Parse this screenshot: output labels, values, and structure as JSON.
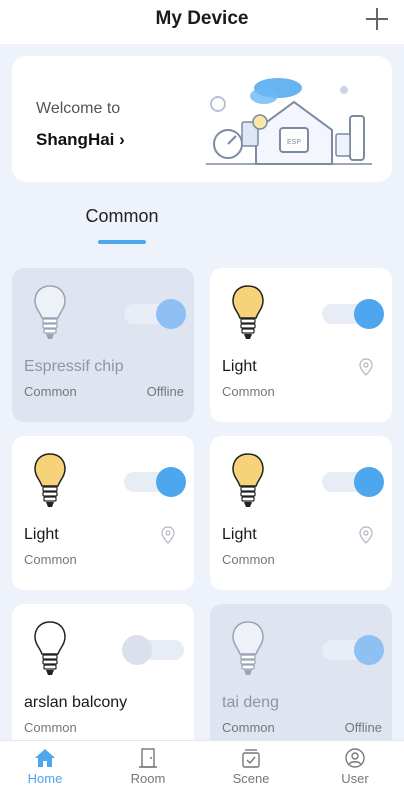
{
  "header": {
    "title": "My Device",
    "add_icon": "plus-icon"
  },
  "welcome": {
    "greeting": "Welcome to",
    "city": "ShangHai",
    "city_icon": "chevron-right-icon"
  },
  "tabs": [
    {
      "label": "Common",
      "active": true
    }
  ],
  "devices": [
    {
      "name": "Espressif chip",
      "room": "Common",
      "status": "Offline",
      "on": true,
      "online": false,
      "bulb_lit": false
    },
    {
      "name": "Light",
      "room": "Common",
      "status": "",
      "on": true,
      "online": true,
      "bulb_lit": true
    },
    {
      "name": "Light",
      "room": "Common",
      "status": "",
      "on": true,
      "online": true,
      "bulb_lit": true
    },
    {
      "name": "Light",
      "room": "Common",
      "status": "",
      "on": true,
      "online": true,
      "bulb_lit": true
    },
    {
      "name": "arslan balcony",
      "room": "Common",
      "status": "",
      "on": false,
      "online": true,
      "bulb_lit": false
    },
    {
      "name": "tai deng",
      "room": "Common",
      "status": "Offline",
      "on": true,
      "online": false,
      "bulb_lit": false
    }
  ],
  "nav": [
    {
      "label": "Home",
      "icon": "home-icon",
      "active": true
    },
    {
      "label": "Room",
      "icon": "door-icon",
      "active": false
    },
    {
      "label": "Scene",
      "icon": "scene-icon",
      "active": false
    },
    {
      "label": "User",
      "icon": "user-icon",
      "active": false
    }
  ],
  "colors": {
    "accent": "#4ea6ee",
    "background": "#eef2fb",
    "offline_card": "#dee4f0",
    "bulb_lit": "#f6d27a"
  }
}
